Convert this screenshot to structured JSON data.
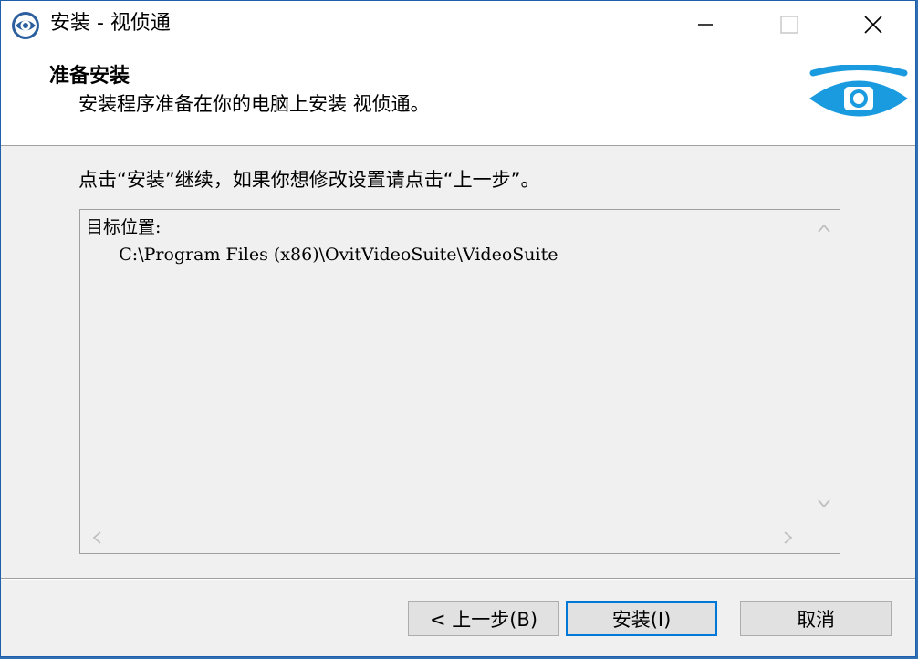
{
  "window": {
    "title": "安装 - 视侦通",
    "accent_color": "#0078d7",
    "icon": "eye-logo-icon"
  },
  "header": {
    "title": "准备安装",
    "subtitle": "安装程序准备在你的电脑上安装 视侦通。",
    "logo": "eye-logo-icon"
  },
  "body": {
    "instruction": "点击“安装”继续，如果你想修改设置请点击“上一步”。",
    "memo": {
      "label": "目标位置:",
      "path": "C:\\Program Files (x86)\\OvitVideoSuite\\VideoSuite"
    }
  },
  "buttons": {
    "back": "< 上一步(B)",
    "install": "安装(I)",
    "cancel": "取消"
  }
}
